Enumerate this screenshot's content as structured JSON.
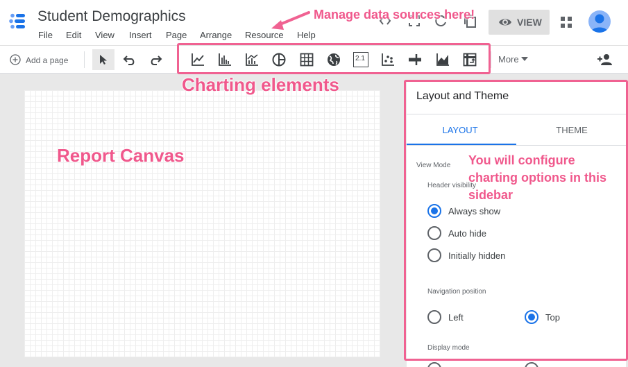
{
  "app": {
    "title": "Student Demographics"
  },
  "menu": [
    "File",
    "Edit",
    "View",
    "Insert",
    "Page",
    "Arrange",
    "Resource",
    "Help"
  ],
  "header": {
    "view_label": "VIEW"
  },
  "toolbar": {
    "add_page_label": "Add a page",
    "chart_icons": [
      "time-series-chart-icon",
      "bar-chart-icon",
      "combo-chart-icon",
      "pie-chart-icon",
      "table-icon",
      "geo-map-icon",
      "scorecard-icon",
      "scatter-chart-icon",
      "bullet-chart-icon",
      "area-chart-icon",
      "pivot-table-icon"
    ],
    "scorecard_text": "2.1",
    "more_label": "More"
  },
  "sidebar": {
    "title": "Layout and Theme",
    "tabs": [
      "LAYOUT",
      "THEME"
    ],
    "active_tab": "LAYOUT",
    "view_mode_label": "View Mode",
    "header_visibility_label": "Header visibility",
    "header_options": [
      "Always show",
      "Auto hide",
      "Initially hidden"
    ],
    "header_selected": "Always show",
    "nav_position_label": "Navigation position",
    "nav_options": [
      "Left",
      "Top"
    ],
    "nav_selected": "Top",
    "display_mode_label": "Display mode"
  },
  "annotations": {
    "data_sources": "Manage data sources here!",
    "charting_elements": "Charting elements",
    "report_canvas": "Report Canvas",
    "sidebar_note": [
      "You will configure",
      "charting options in this",
      "sidebar"
    ]
  },
  "colors": {
    "accent": "#1a73e8",
    "annotation": "#f06292"
  }
}
